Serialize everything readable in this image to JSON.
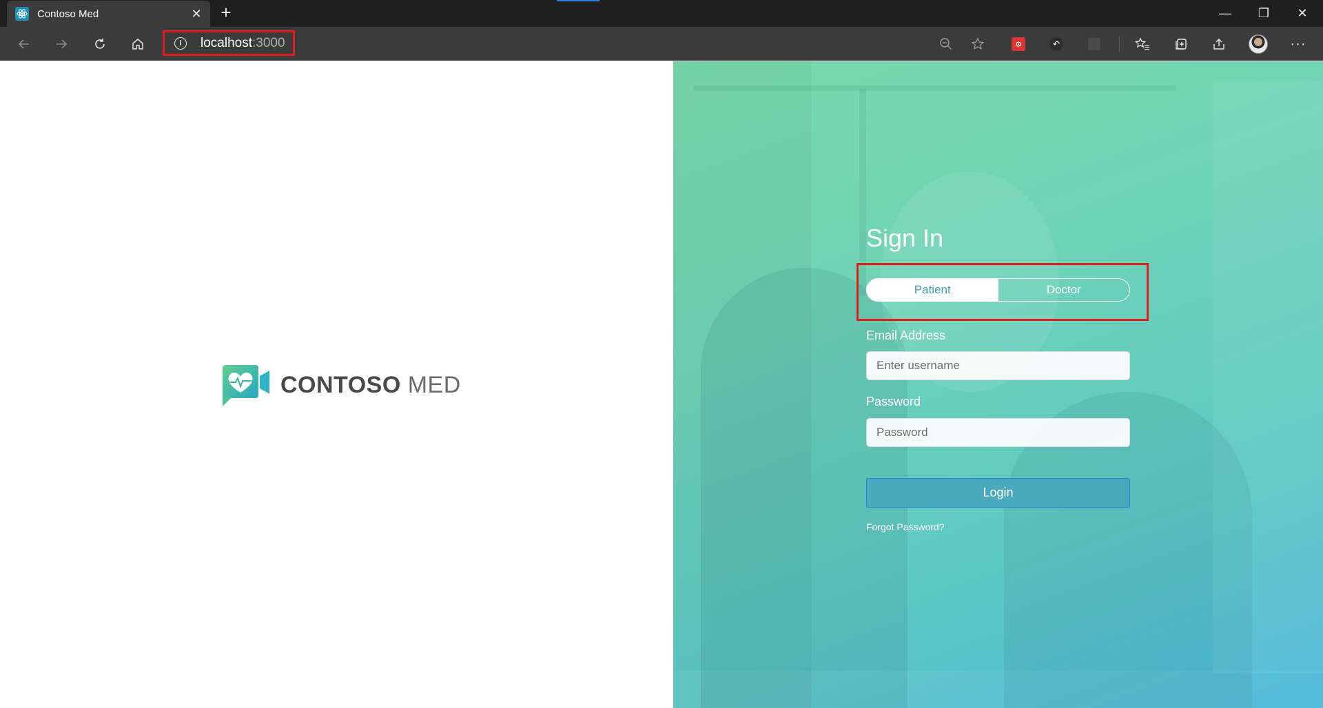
{
  "browser": {
    "tab": {
      "title": "Contoso Med",
      "close_glyph": "✕",
      "favicon": "react-icon"
    },
    "new_tab_glyph": "+",
    "window_controls": {
      "minimize": "—",
      "restore": "❐",
      "close": "✕"
    },
    "address": {
      "host": "localhost",
      "port": ":3000"
    },
    "toolbar_icons": [
      "back-icon",
      "forward-icon",
      "refresh-icon",
      "home-icon",
      "zoom-icon",
      "favorite-star-icon",
      "extension-icon",
      "extension-icon",
      "extension-icon",
      "favorites-icon",
      "collections-icon",
      "share-icon",
      "profile-avatar",
      "more-icon"
    ],
    "more_glyph": "···"
  },
  "brand": {
    "name_bold": "CONTOSO",
    "name_light": "MED"
  },
  "signin": {
    "title": "Sign In",
    "roles": [
      "Patient",
      "Doctor"
    ],
    "selected_role": "Patient",
    "email_label": "Email Address",
    "email_placeholder": "Enter username",
    "password_label": "Password",
    "password_placeholder": "Password",
    "login_label": "Login",
    "forgot_label": "Forgot Password?"
  },
  "colors": {
    "highlight": "#e01e1e",
    "gradient_start": "#78d9a9",
    "gradient_end": "#4db7da",
    "login_button": "#4aaabd",
    "active_role_text": "#3f9fb4"
  }
}
